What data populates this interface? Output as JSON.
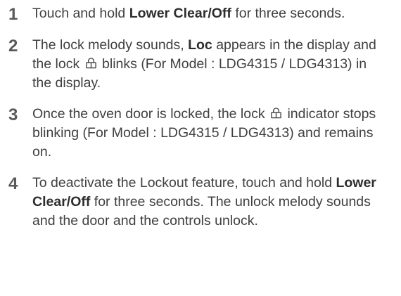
{
  "steps": [
    {
      "number": "1",
      "t1": "Touch and hold ",
      "bold1": "Lower Clear/Off",
      "t2": " for three seconds."
    },
    {
      "number": "2",
      "t1": "The lock melody sounds, ",
      "bold1": "Loc",
      "t2": " appears in the display and the lock ",
      "icon": "lock-icon",
      "t3": " blinks (For Model : LDG4315 / LDG4313) in the display."
    },
    {
      "number": "3",
      "t1": "Once the oven door is locked, the lock ",
      "icon": "lock-icon",
      "t2": " indicator stops blinking (For Model : LDG4315 / LDG4313) and remains on."
    },
    {
      "number": "4",
      "t1": "To deactivate the Lockout feature, touch and hold ",
      "bold1": "Lower Clear/Off",
      "t2": " for three seconds. The unlock melody sounds and the door and the controls unlock."
    }
  ]
}
